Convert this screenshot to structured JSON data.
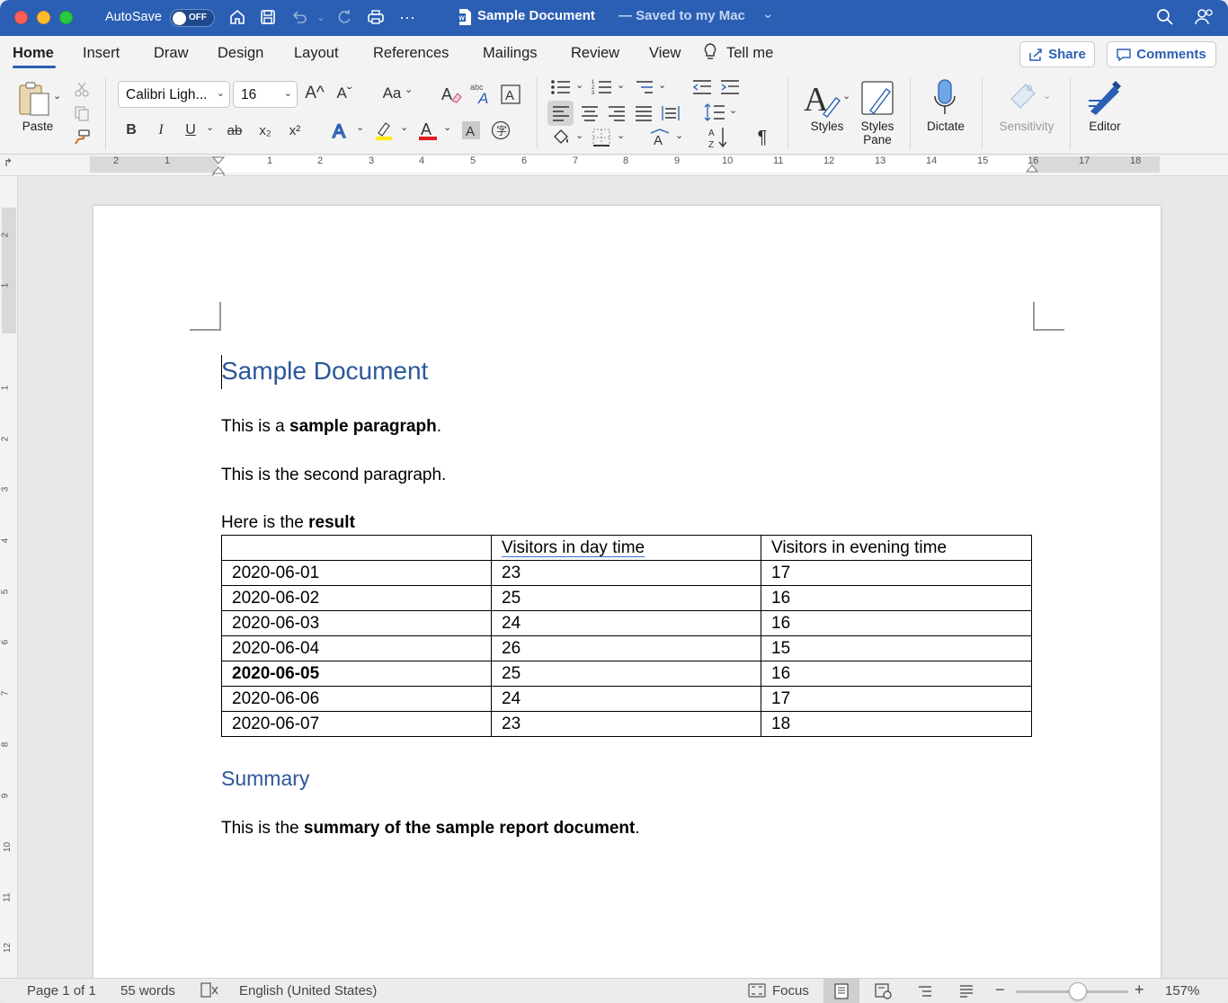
{
  "titlebar": {
    "autosave_label": "AutoSave",
    "autosave_state": "OFF",
    "doc_name": "Sample Document",
    "saved_status": "— Saved to my Mac",
    "chevron": "⌄"
  },
  "tabs": [
    "Home",
    "Insert",
    "Draw",
    "Design",
    "Layout",
    "References",
    "Mailings",
    "Review",
    "View",
    "Tell me"
  ],
  "share_label": "Share",
  "comments_label": "Comments",
  "ribbon": {
    "paste_label": "Paste",
    "font_name": "Calibri Ligh...",
    "font_size": "16",
    "bold": "B",
    "italic": "I",
    "underline": "U",
    "strike": "ab",
    "subscript": "x₂",
    "superscript": "x²",
    "change_case": "Aa",
    "grow_font": "A^",
    "shrink_font": "Aˇ",
    "styles_label": "Styles",
    "styles_pane_label": "Styles\nPane",
    "styles_pane_line1": "Styles",
    "styles_pane_line2": "Pane",
    "dictate_label": "Dictate",
    "sensitivity_label": "Sensitivity",
    "editor_label": "Editor",
    "pilcrow": "¶",
    "colors": {
      "highlight": "#ffeb00",
      "font_color": "#e31b1b",
      "text_effect": "#2b5fb3"
    }
  },
  "ruler": {
    "h_numbers": [
      "2",
      "1",
      "1",
      "2",
      "3",
      "4",
      "5",
      "6",
      "7",
      "8",
      "9",
      "10",
      "11",
      "12",
      "13",
      "14",
      "15",
      "16",
      "17",
      "18"
    ],
    "v_numbers": [
      "2",
      "1",
      "1",
      "2",
      "3",
      "4",
      "5",
      "6",
      "7",
      "8",
      "9",
      "10",
      "11",
      "12"
    ]
  },
  "document": {
    "title": "Sample Document",
    "p1_start": "This is a ",
    "p1_bold": "sample paragraph",
    "p1_end": ".",
    "p2": "This is the second paragraph.",
    "p3_start": "Here is the ",
    "p3_bold": "result",
    "table": {
      "header": [
        "",
        "Visitors in day time",
        "Visitors in evening time"
      ],
      "rows": [
        [
          "2020-06-01",
          "23",
          "17"
        ],
        [
          "2020-06-02",
          "25",
          "16"
        ],
        [
          "2020-06-03",
          "24",
          "16"
        ],
        [
          "2020-06-04",
          "26",
          "15"
        ],
        [
          "2020-06-05",
          "25",
          "16"
        ],
        [
          "2020-06-06",
          "24",
          "17"
        ],
        [
          "2020-06-07",
          "23",
          "18"
        ]
      ]
    },
    "summary_heading": "Summary",
    "summary_start": "This is the ",
    "summary_bold": "summary of the sample report document",
    "summary_end": "."
  },
  "status": {
    "page": "Page 1 of 1",
    "words": "55 words",
    "language": "English (United States)",
    "focus": "Focus",
    "zoom": "157%",
    "zoom_minus": "−",
    "zoom_plus": "+"
  }
}
